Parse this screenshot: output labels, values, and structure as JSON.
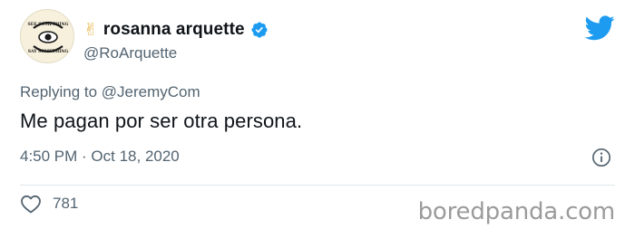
{
  "tweet": {
    "avatar_text_top": "SEE SOMETHING",
    "avatar_text_bottom": "SAY SOMETHING",
    "emoji": "✌",
    "display_name": "rosanna arquette",
    "handle": "@RoArquette",
    "reply_prefix": "Replying to ",
    "reply_to": "@JeremyCom",
    "text": "Me pagan por ser otra persona.",
    "timestamp": "4:50 PM · Oct 18, 2020",
    "like_count": "781"
  },
  "watermark": "boredpanda.com",
  "colors": {
    "twitter_blue": "#1d9bf0",
    "secondary_text": "#536471",
    "divider": "#e1e8ed"
  },
  "icons": {
    "verified": "verified-badge-icon",
    "bird": "twitter-bird-icon",
    "info": "info-icon",
    "like": "heart-icon"
  }
}
